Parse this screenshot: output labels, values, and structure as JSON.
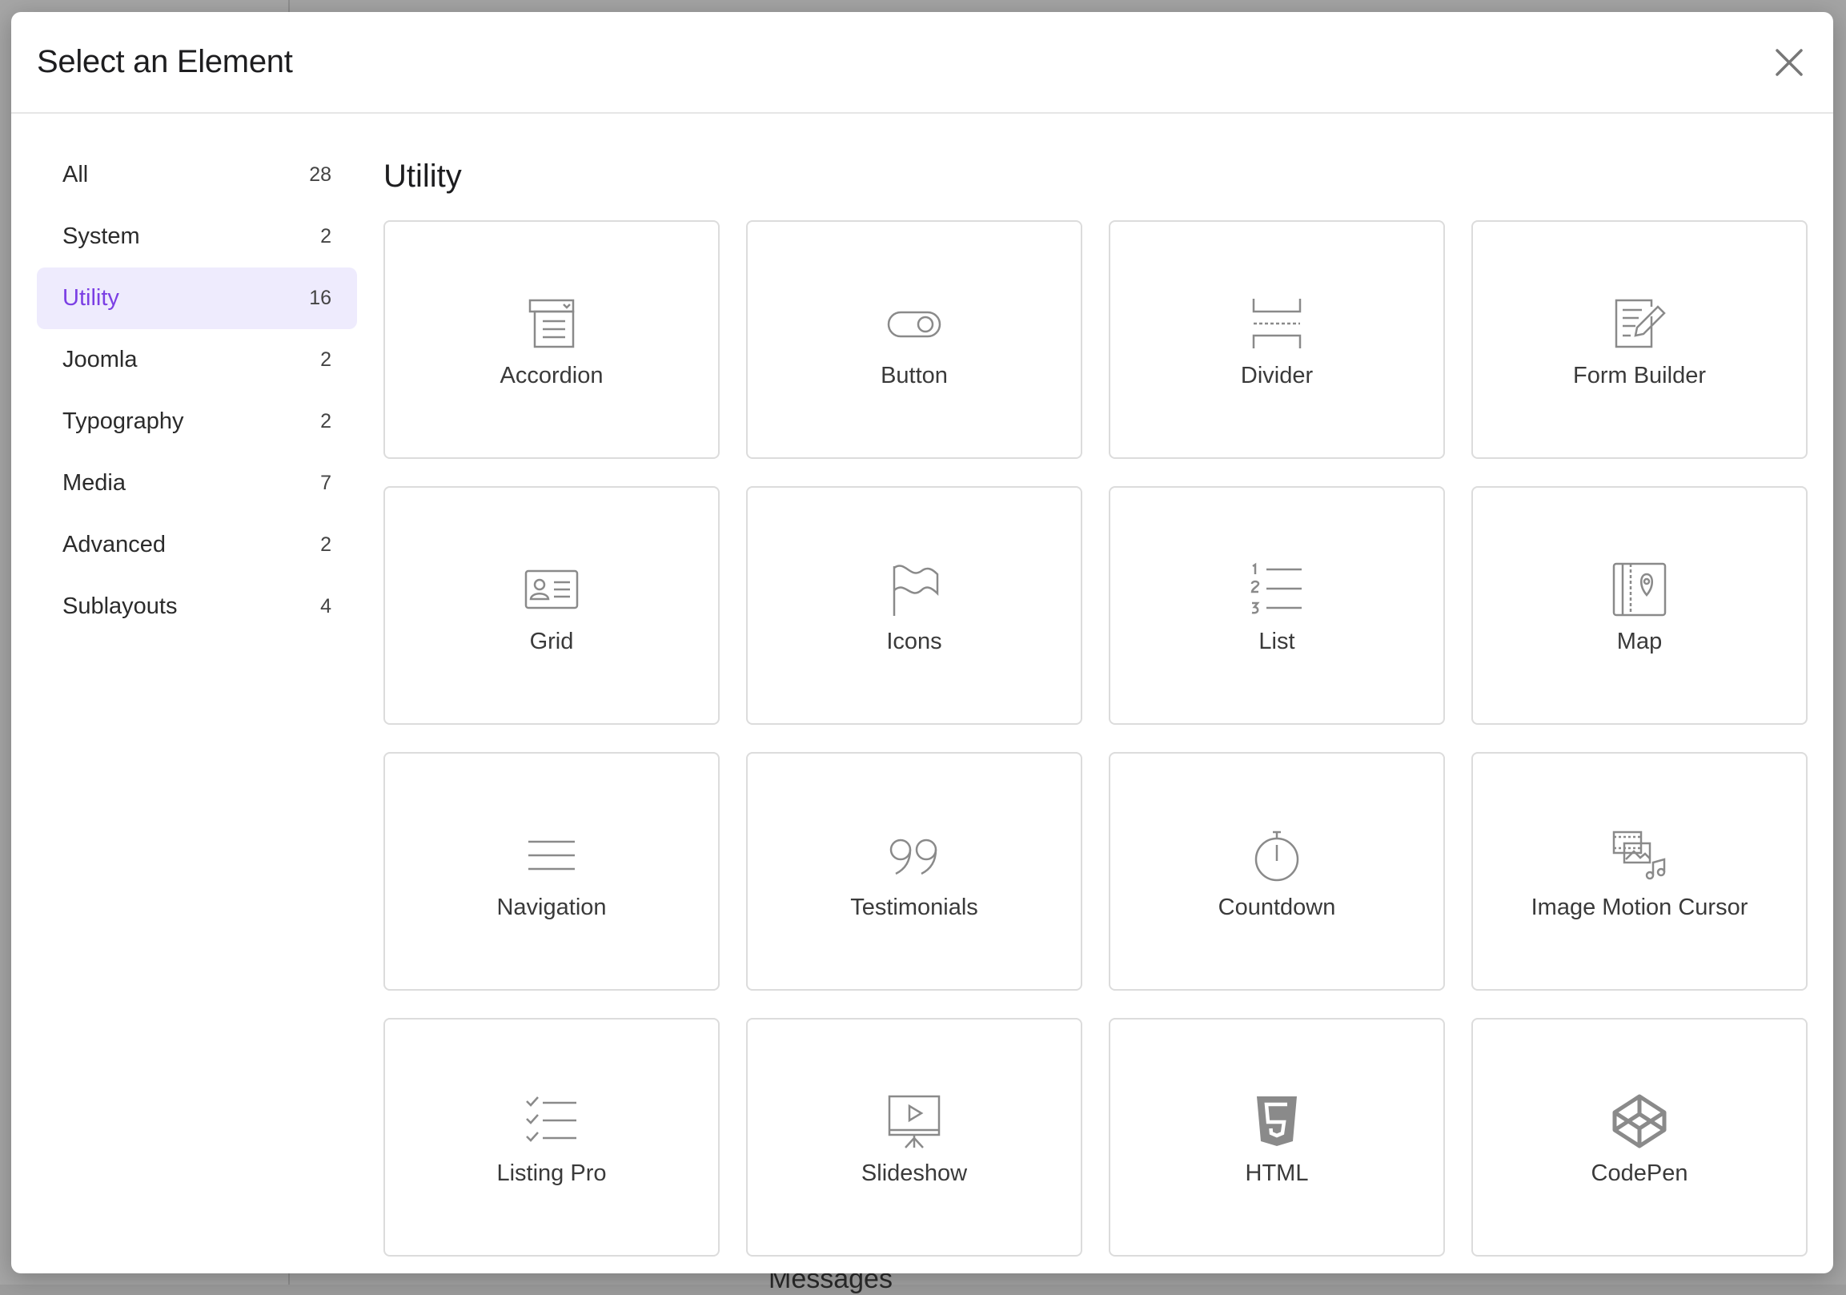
{
  "background": {
    "bottom_text": "Messages"
  },
  "modal": {
    "title": "Select an Element"
  },
  "sidebar": {
    "items": [
      {
        "label": "All",
        "count": "28"
      },
      {
        "label": "System",
        "count": "2"
      },
      {
        "label": "Utility",
        "count": "16",
        "active": true
      },
      {
        "label": "Joomla",
        "count": "2"
      },
      {
        "label": "Typography",
        "count": "2"
      },
      {
        "label": "Media",
        "count": "7"
      },
      {
        "label": "Advanced",
        "count": "2"
      },
      {
        "label": "Sublayouts",
        "count": "4"
      }
    ]
  },
  "main": {
    "section_title": "Utility",
    "elements": [
      {
        "label": "Accordion",
        "icon": "accordion-icon"
      },
      {
        "label": "Button",
        "icon": "button-toggle-icon"
      },
      {
        "label": "Divider",
        "icon": "divider-icon"
      },
      {
        "label": "Form Builder",
        "icon": "form-builder-icon"
      },
      {
        "label": "Grid",
        "icon": "grid-card-icon"
      },
      {
        "label": "Icons",
        "icon": "flag-icon"
      },
      {
        "label": "List",
        "icon": "numbered-list-icon"
      },
      {
        "label": "Map",
        "icon": "map-icon"
      },
      {
        "label": "Navigation",
        "icon": "menu-lines-icon"
      },
      {
        "label": "Testimonials",
        "icon": "quote-icon"
      },
      {
        "label": "Countdown",
        "icon": "stopwatch-icon"
      },
      {
        "label": "Image Motion Cursor",
        "icon": "image-motion-icon"
      },
      {
        "label": "Listing Pro",
        "icon": "checklist-icon"
      },
      {
        "label": "Slideshow",
        "icon": "slideshow-icon"
      },
      {
        "label": "HTML",
        "icon": "html5-icon"
      },
      {
        "label": "CodePen",
        "icon": "codepen-icon"
      }
    ]
  },
  "colors": {
    "accent": "#7b3fe4",
    "active_bg": "#eeebfd",
    "icon_gray": "#8a8a8a",
    "border": "#dcdcdc"
  }
}
